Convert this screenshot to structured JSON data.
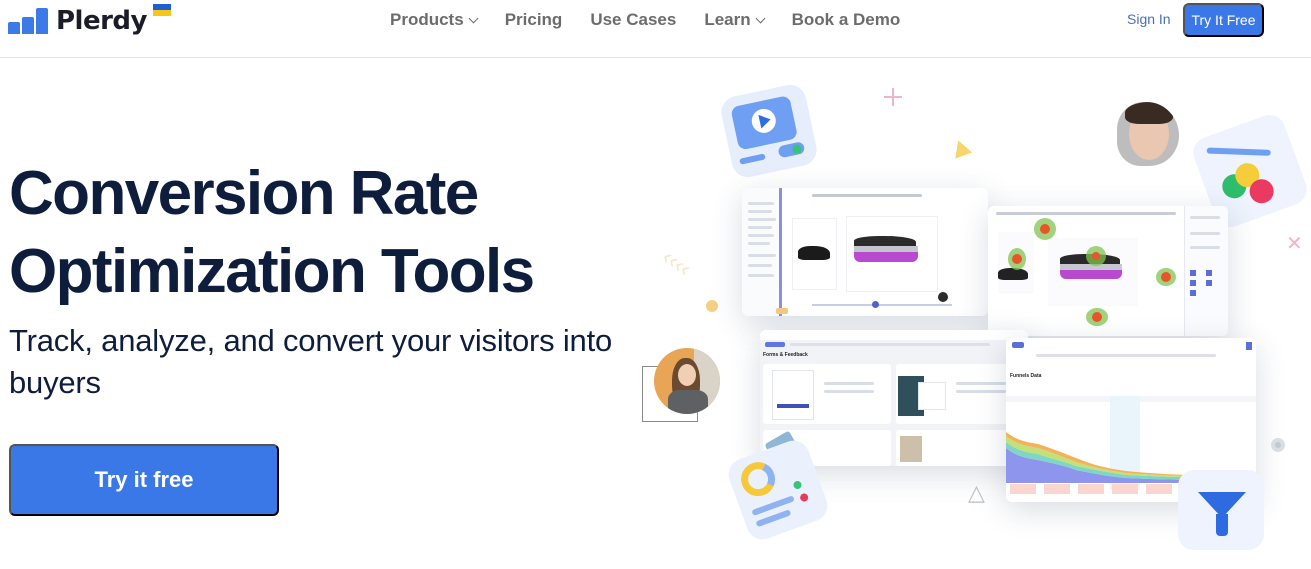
{
  "header": {
    "logo_text": "Plerdy",
    "nav": [
      {
        "label": "Products",
        "has_dropdown": true
      },
      {
        "label": "Pricing",
        "has_dropdown": false
      },
      {
        "label": "Use Cases",
        "has_dropdown": false
      },
      {
        "label": "Learn",
        "has_dropdown": true
      },
      {
        "label": "Book a Demo",
        "has_dropdown": false
      }
    ],
    "sign_in_label": "Sign In",
    "cta_label": "Try It Free"
  },
  "hero": {
    "title_line1": "Conversion Rate",
    "title_line2": "Optimization Tools",
    "subtitle": "Track, analyze, and convert your visitors into buyers",
    "cta_label": "Try it free"
  },
  "illustration": {
    "panels": {
      "forms_title": "Forms & Feedback",
      "funnel_title": "Funnels Data"
    }
  },
  "colors": {
    "brand_blue": "#3b78e7",
    "heading_navy": "#0f1d3d",
    "nav_gray": "#6c6c6c",
    "flag_blue": "#1f5fd4",
    "flag_yellow": "#f5c518"
  }
}
